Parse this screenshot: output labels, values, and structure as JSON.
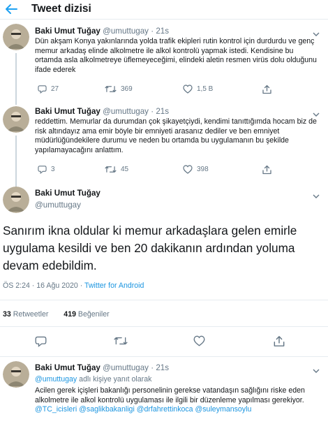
{
  "header": {
    "title": "Tweet dizisi"
  },
  "tweets": [
    {
      "name": "Baki Umut Tuğay",
      "handle": "@umuttugay",
      "sep": "·",
      "time": "21s",
      "text": "Dün akşam Konya yakınlarında yolda trafik ekipleri rutin kontrol için durdurdu ve genç memur arkadaş elinde alkolmetre ile alkol kontrolü yapmak istedi. Kendisine bu ortamda asla alkolmetreye üflemeyeceğimi, elindeki aletin resmen virüs dolu olduğunu ifade ederek",
      "replies": "27",
      "retweets": "369",
      "likes": "1,5 B"
    },
    {
      "name": "Baki Umut Tuğay",
      "handle": "@umuttugay",
      "sep": "·",
      "time": "21s",
      "text": "reddettim. Memurlar da durumdan çok şikayetçiydi, kendimi tanıttığımda hocam biz de risk altındayız ama emir böyle bir emniyeti arasanız dediler ve ben emniyet müdürlüğündekilere durumu ve neden bu ortamda bu uygulamanın bu şekilde yapılamayacağını anlattım.",
      "replies": "3",
      "retweets": "45",
      "likes": "398"
    }
  ],
  "main": {
    "name": "Baki Umut Tuğay",
    "handle": "@umuttugay",
    "text": "Sanırım ikna oldular ki memur arkadaşlara gelen emirle uygulama kesildi ve ben 20 dakikanın ardından yoluma devam edebildim.",
    "timestamp": "ÖS 2:24 · 16 Ağu 2020 · ",
    "source": "Twitter for Android",
    "retweets_count": "33",
    "retweets_label": " Retweetler",
    "likes_count": "419",
    "likes_label": " Beğeniler"
  },
  "reply": {
    "name": "Baki Umut Tuğay",
    "handle": "@umuttugay",
    "sep": "·",
    "time": "21s",
    "reply_to_mention": "@umuttugay",
    "reply_to_suffix": " adlı kişiye yanıt olarak",
    "text": "Acilen gerek içişleri bakanlığı personelinin gerekse vatandaşın sağlığını riske eden alkolmetre ile alkol kontrolü uygulaması ile ilgili bir düzenleme yapılması gerekiyor. ",
    "mentions": "@TC_icisleri @saglikbakanligi @drfahrettinkoca @suleymansoylu"
  },
  "icons": {
    "back": "back-arrow-icon",
    "reply": "reply-icon",
    "retweet": "retweet-icon",
    "like": "heart-icon",
    "share": "share-icon",
    "caret": "chevron-down-icon"
  },
  "colors": {
    "accent": "#1da1f2",
    "link": "#1b95e0",
    "muted": "#657786",
    "text": "#14171a"
  }
}
